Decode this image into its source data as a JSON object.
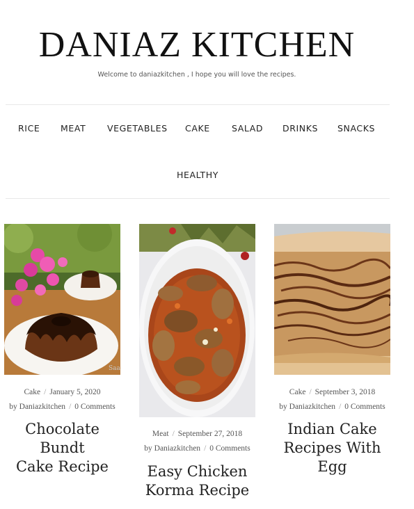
{
  "site": {
    "title": "DANIAZ KITCHEN",
    "tagline": "Welcome to daniazkitchen , I hope you will love the recipes."
  },
  "nav": {
    "items": [
      {
        "label": "RICE"
      },
      {
        "label": "MEAT"
      },
      {
        "label": "VEGETABLES"
      },
      {
        "label": "CAKE"
      },
      {
        "label": "SALAD"
      },
      {
        "label": "DRINKS"
      },
      {
        "label": "SNACKS"
      },
      {
        "label": "HEALTHY"
      }
    ]
  },
  "posts": [
    {
      "category": "Cake",
      "date": "January 5, 2020",
      "by": "by",
      "author": "Daniazkitchen",
      "comments": "0 Comments",
      "title_line1": "Chocolate Bundt",
      "title_line2": "Cake Recipe",
      "title_line3": ""
    },
    {
      "category": "Meat",
      "date": "September 27, 2018",
      "by": "by",
      "author": "Daniazkitchen",
      "comments": "0 Comments",
      "title_line1": "Easy Chicken",
      "title_line2": "Korma Recipe",
      "title_line3": ""
    },
    {
      "category": "Cake",
      "date": "September 3, 2018",
      "by": "by",
      "author": "Daniazkitchen",
      "comments": "0 Comments",
      "title_line1": "Indian Cake",
      "title_line2": "Recipes With",
      "title_line3": "Egg"
    }
  ],
  "meta_separator": "/",
  "image_watermark": "Saad"
}
